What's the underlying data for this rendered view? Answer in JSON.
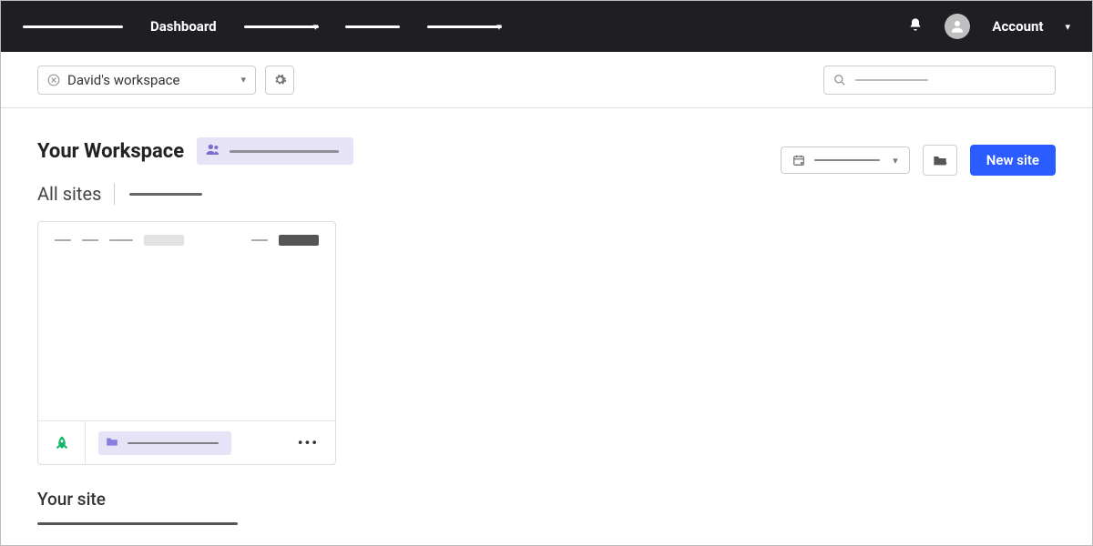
{
  "nav": {
    "dashboard_label": "Dashboard",
    "account_label": "Account"
  },
  "workspace_selector": {
    "name": "David's workspace"
  },
  "main": {
    "workspace_title": "Your Workspace",
    "all_sites_label": "All sites",
    "your_site_label": "Your site"
  },
  "actions": {
    "new_site_label": "New site"
  }
}
